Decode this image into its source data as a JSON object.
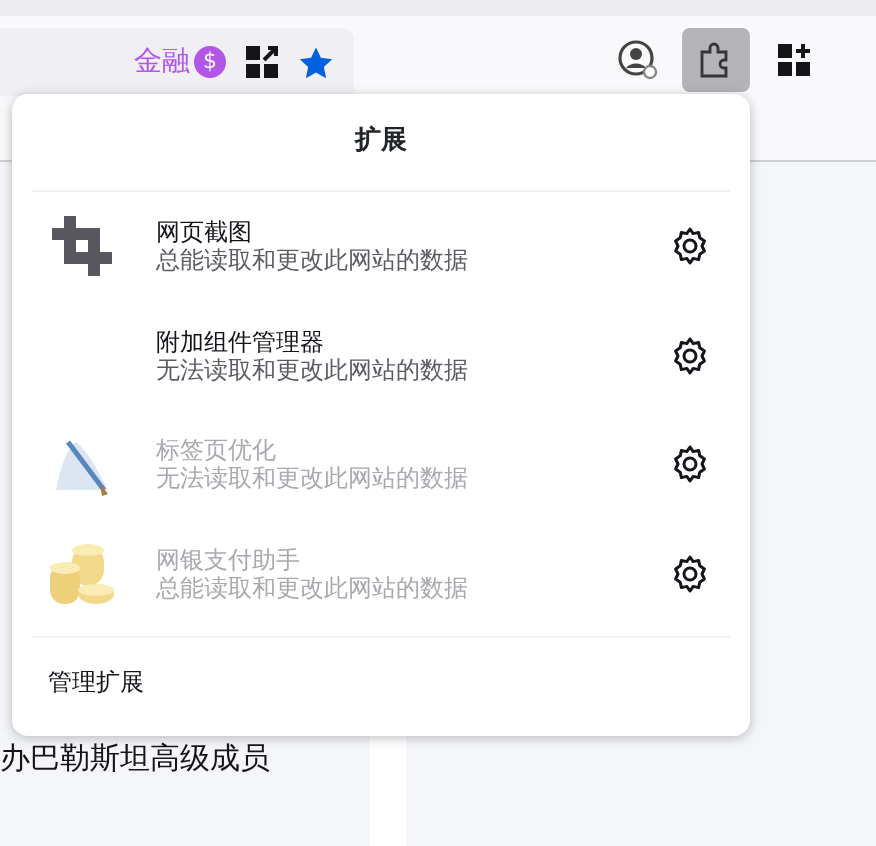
{
  "toolbar": {
    "url_label": "金融",
    "currency_symbol": "$",
    "extensions_button": {
      "selected": true
    }
  },
  "panel": {
    "title": "扩展",
    "extensions": [
      {
        "name": "网页截图",
        "permission": "总能读取和更改此网站的数据",
        "disabled": false
      },
      {
        "name": "附加组件管理器",
        "permission": "无法读取和更改此网站的数据",
        "disabled": false
      },
      {
        "name": "标签页优化",
        "permission": "无法读取和更改此网站的数据",
        "disabled": true
      },
      {
        "name": "网银支付助手",
        "permission": "总能读取和更改此网站的数据",
        "disabled": true
      }
    ],
    "footer_link": "管理扩展"
  },
  "page": {
    "lines": [
      "办巴勒斯坦高级成员"
    ]
  }
}
